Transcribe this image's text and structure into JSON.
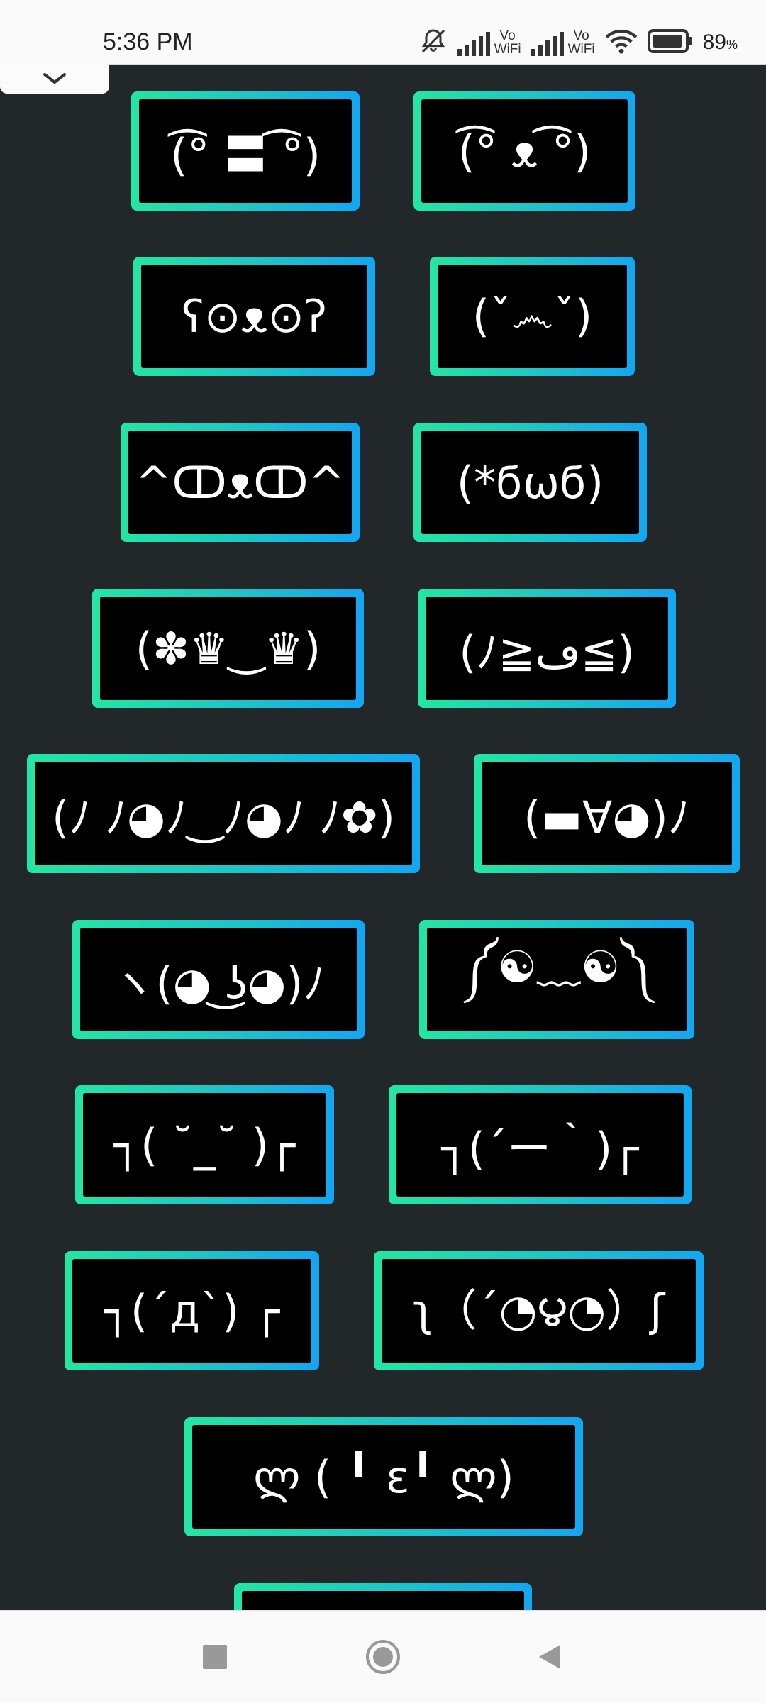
{
  "status_bar": {
    "time": "5:36 PM",
    "vowifi_1": "Vo\nWiFi",
    "vowifi_1_top": "Vo",
    "vowifi_1_bottom": "WiFi",
    "vowifi_2_top": "Vo",
    "vowifi_2_bottom": "WiFi",
    "battery_percent": "89",
    "battery_unit": "%"
  },
  "emoticons": [
    "(͡° 〓 ͡°)",
    "(͡° ᴥ ͡°)",
    "ʕ⊙ᴥ⊙ʔ",
    "(ˇ෴ˇ)",
    "^ↀᴥↀ^",
    "(*ϭωϭ)",
    "(✽♛‿♛)",
    "(ﾉ≧ڡ≦)",
    "(ﾉ ﾉ◕ﾉ‿ﾉ◕ﾉ ﾉ✿)",
    "(▬∀◕)ﾉ",
    "ヽ(◕ ͜ʖ◕)ﾉ",
    "༼☯﹏☯༽",
    "┐( ˘_˘ )┌",
    "┐(´ー｀)┌",
    "┐(´д`) ┌",
    "ʅ（´◔౪◔）ʃ",
    "ლ ( ╹ ε╹ ლ)"
  ],
  "colors": {
    "background": "#22272a",
    "gradient_start": "#23e6a3",
    "gradient_end": "#13a6f2"
  }
}
